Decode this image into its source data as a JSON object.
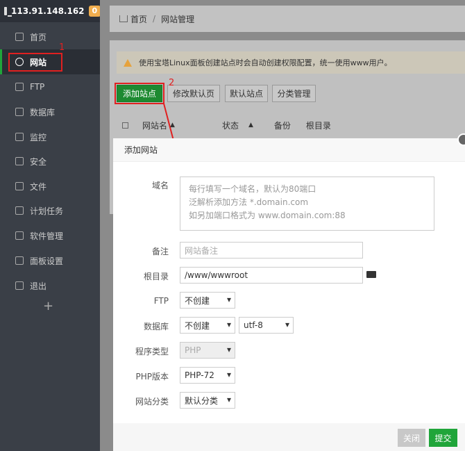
{
  "topbar": {
    "ip": "113.91.148.162",
    "badge": "0"
  },
  "sidebar": {
    "items": [
      {
        "label": "首页"
      },
      {
        "label": "网站"
      },
      {
        "label": "FTP"
      },
      {
        "label": "数据库"
      },
      {
        "label": "监控"
      },
      {
        "label": "安全"
      },
      {
        "label": "文件"
      },
      {
        "label": "计划任务"
      },
      {
        "label": "软件管理"
      },
      {
        "label": "面板设置"
      },
      {
        "label": "退出"
      }
    ],
    "add": "+"
  },
  "annotations": {
    "one": "1",
    "two": "2"
  },
  "breadcrumb": {
    "home": "首页",
    "sep": "/",
    "current": "网站管理"
  },
  "notice": "使用宝塔Linux面板创建站点时会自动创建权限配置，统一使用www用户。",
  "toolbar": {
    "add_site": "添加站点",
    "edit_default": "修改默认页",
    "default_site": "默认站点",
    "category_mgmt": "分类管理"
  },
  "table": {
    "headers": [
      "网站名",
      "状态",
      "备份",
      "根目录"
    ]
  },
  "modal": {
    "title": "添加网站",
    "domain_label": "域名",
    "domain_placeholder": [
      "每行填写一个域名，默认为80端口",
      "泛解析添加方法 *.domain.com",
      "如另加端口格式为 www.domain.com:88"
    ],
    "remark_label": "备注",
    "remark_placeholder": "网站备注",
    "root_label": "根目录",
    "root_value": "/www/wwwroot",
    "ftp_label": "FTP",
    "ftp_value": "不创建",
    "db_label": "数据库",
    "db_value": "不创建",
    "db_charset": "utf-8",
    "prog_label": "程序类型",
    "prog_value": "PHP",
    "php_label": "PHP版本",
    "php_value": "PHP-72",
    "cat_label": "网站分类",
    "cat_value": "默认分类",
    "close": "关闭",
    "submit": "提交"
  },
  "colors": {
    "accent": "#20a53a",
    "annotation": "#e02020"
  }
}
